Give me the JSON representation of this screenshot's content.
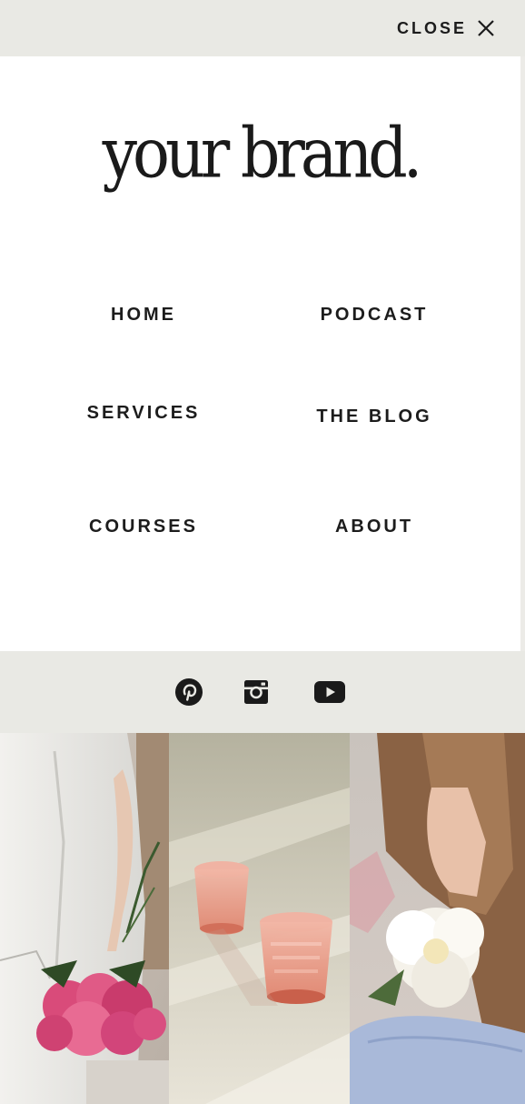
{
  "menu": {
    "close_label": "CLOSE",
    "close_icon": "close-icon"
  },
  "brand": {
    "logo_text": "your brand."
  },
  "nav": {
    "items": [
      {
        "label": "HOME"
      },
      {
        "label": "PODCAST"
      },
      {
        "label": "SERVICES"
      },
      {
        "label": "THE BLOG"
      },
      {
        "label": "COURSES"
      },
      {
        "label": "ABOUT"
      }
    ]
  },
  "social": {
    "icons": [
      "pinterest-icon",
      "instagram-icon",
      "youtube-icon"
    ]
  },
  "gallery": {
    "images": [
      "woman-with-pink-peonies",
      "pink-glasses-on-linen",
      "woman-with-white-peony"
    ]
  },
  "colors": {
    "bar_background": "#e9e9e4",
    "text": "#1c1c1c",
    "page_background": "#ffffff"
  }
}
